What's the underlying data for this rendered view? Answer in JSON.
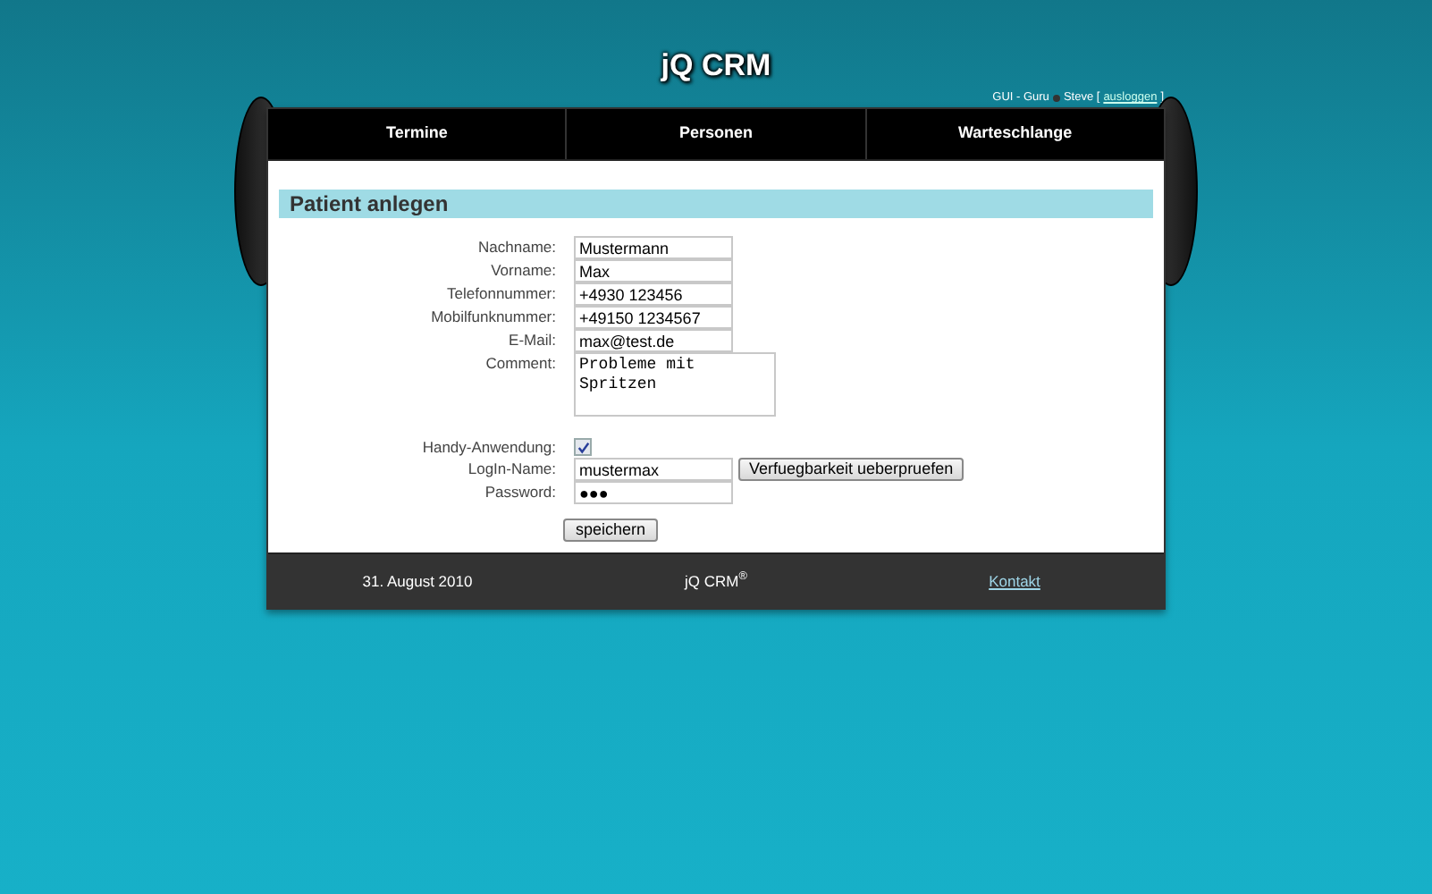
{
  "header": {
    "title": "jQ CRM",
    "user_role": "GUI - Guru",
    "user_name": "Steve",
    "logout_open": "[",
    "logout_link": "ausloggen",
    "logout_close": "]"
  },
  "nav": [
    {
      "label": "Termine"
    },
    {
      "label": "Personen"
    },
    {
      "label": "Warteschlange"
    }
  ],
  "form": {
    "heading": "Patient anlegen",
    "fields": [
      {
        "kind": "text",
        "label": "Nachname:",
        "value": "Mustermann"
      },
      {
        "kind": "text",
        "label": "Vorname:",
        "value": "Max"
      },
      {
        "kind": "text",
        "label": "Telefonnummer:",
        "value": "+4930 123456"
      },
      {
        "kind": "text",
        "label": "Mobilfunknummer:",
        "value": "+49150 1234567"
      },
      {
        "kind": "text",
        "label": "E-Mail:",
        "value": "max@test.de"
      },
      {
        "kind": "textarea",
        "label": "Comment:",
        "value": "Probleme mit Spritzen"
      },
      {
        "kind": "checkbox",
        "label": "Handy-Anwendung:",
        "checked": true
      },
      {
        "kind": "text_button",
        "label": "LogIn-Name:",
        "value": "mustermax",
        "button": "Verfuegbarkeit ueberpruefen"
      },
      {
        "kind": "text",
        "label": "Password:",
        "value": "●●●"
      }
    ],
    "submit": "speichern"
  },
  "footer": {
    "date": "31. August 2010",
    "brand": "jQ CRM$^{®}$",
    "contact_link": "Kontakt"
  }
}
